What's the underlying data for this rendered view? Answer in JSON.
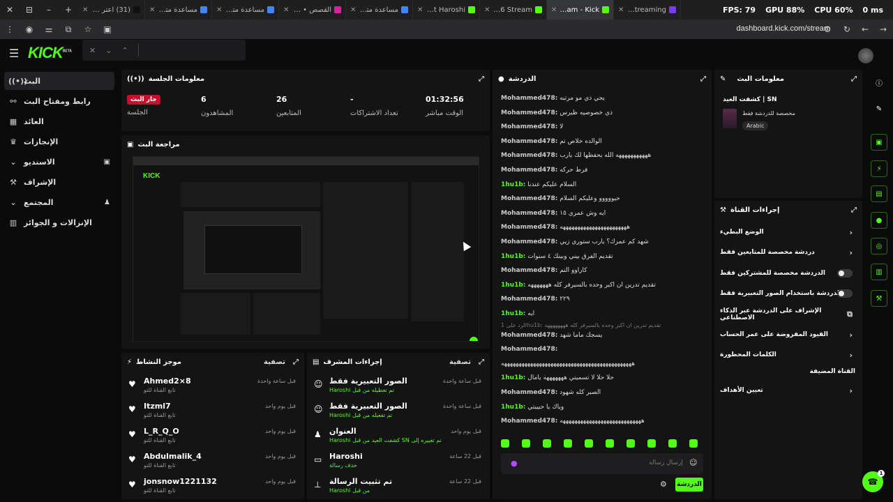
{
  "browser": {
    "tabs": [
      {
        "label": "(31) اعتر على",
        "color": "#111111"
      },
      {
        "label": "مساعدة متصفح",
        "color": "#4285f4"
      },
      {
        "label": "مساعدة متصفح",
        "color": "#4285f4"
      },
      {
        "label": "القصص • rami",
        "color": "#d6249f"
      },
      {
        "label": "مساعدة متصفح",
        "color": "#4285f4"
      },
      {
        "label": "About Haroshi",
        "color": "#53fc18"
      },
      {
        "label": "kh_e6 Stream",
        "color": "#53fc18"
      },
      {
        "label": "Stream - Kick",
        "color": "#53fc18"
      },
      {
        "label": "Kick Streaming",
        "color": "#7c3aed"
      }
    ],
    "active_tab": 7,
    "fps": "FPS: 79",
    "gpu": "GPU 88%",
    "cpu": "CPU 60%",
    "ms": "0 ms",
    "url": "dashboard.kick.com/stream"
  },
  "nav": {
    "logo": "KICK",
    "logo_tag": "BETA"
  },
  "sidebar": {
    "items": [
      {
        "label": "البث",
        "icon": "live-icon"
      },
      {
        "label": "رابط ومفتاح البث",
        "icon": "link-icon"
      },
      {
        "label": "العائد",
        "icon": "revenue-icon"
      },
      {
        "label": "الإنجازات",
        "icon": "trophy-icon"
      },
      {
        "label": "الاستديو",
        "icon": "chevron-down-icon"
      },
      {
        "label": "الإشراف",
        "icon": "wrench-icon"
      },
      {
        "label": "المجتمع",
        "icon": "chevron-down-icon"
      },
      {
        "label": "الإنزالات و الجوائز",
        "icon": "drops-icon"
      }
    ]
  },
  "session": {
    "title": "معلومات الجلسة",
    "live_badge": "جار البث",
    "session_label": "الجلسة",
    "viewers_value": "6",
    "viewers_label": "المشاهدون",
    "followers_value": "26",
    "followers_label": "المتابعين",
    "subs_value": "-",
    "subs_label": "تعداد الاشتراكات",
    "time_value": "01:32:56",
    "time_label": "الوقت مباشر"
  },
  "preview": {
    "title": "مراجعة البث"
  },
  "activity": {
    "title": "موجز النشاط",
    "filter": "تصفية",
    "items": [
      {
        "name": "Ahmed2×8",
        "sub": "تابع القناة للتو",
        "time": "قبل ساعة واحدة"
      },
      {
        "name": "Itzml7",
        "sub": "تابع القناة للتو",
        "time": "قبل يوم واحد"
      },
      {
        "name": "L_R_Q_O",
        "sub": "تابع القناة للتو",
        "time": "قبل يوم واحد"
      },
      {
        "name": "Abdulmalik_4",
        "sub": "تابع القناة للتو",
        "time": "قبل يوم واحد"
      },
      {
        "name": "jonsnow1221132",
        "sub": "تابع القناة للتو",
        "time": "قبل يوم واحد"
      }
    ]
  },
  "modactions": {
    "title": "إجراءات المشرف",
    "filter": "تصفية",
    "items": [
      {
        "name": "الصور التعبيرية فقط",
        "sub": "Haroshi تم تعطيله من قبل",
        "time": "قبل ساعة واحدة"
      },
      {
        "name": "الصور التعبيرية فقط",
        "sub": "Haroshi تم تفعيله من قبل",
        "time": "قبل ساعة واحدة"
      },
      {
        "name": "العنوان",
        "sub": "Haroshi كشفت العيد من قبل SN تم تغييره إلى",
        "time": "قبل يوم واحد"
      },
      {
        "name": "Haroshi",
        "sub": "حذف رسالة",
        "time": "قبل 22 ساعة"
      },
      {
        "name": "تم تثبيت الرسالة",
        "sub": "Haroshi من قبل",
        "time": "قبل 22 ساعة"
      }
    ]
  },
  "chat": {
    "title": "الدردشة",
    "messages": [
      {
        "user": "Mohammed478:",
        "text": "يجي ذي مو مرتبه",
        "green": false
      },
      {
        "user": "Mohammed478:",
        "text": "ذي خصوصيه ظيرس",
        "green": false
      },
      {
        "user": "Mohammed478:",
        "text": "لا",
        "green": false
      },
      {
        "user": "Mohammed478:",
        "text": "الوالده خلاص تم",
        "green": false
      },
      {
        "user": "Mohammed478:",
        "text": "هههههههههههه الله يحفظها لك يارب",
        "green": false
      },
      {
        "user": "Mohammed478:",
        "text": "فرط حركه",
        "green": false
      },
      {
        "user": "1hu1b:",
        "text": "السلام عليكم عندنا",
        "green": true
      },
      {
        "user": "Mohammed478:",
        "text": "حيووووو وعليكم السلام",
        "green": false
      },
      {
        "user": "Mohammed478:",
        "text": "ايه وش عمري ١٥",
        "green": false
      },
      {
        "user": "Mohammed478:",
        "text": "هههههههههههههههههههههههه",
        "green": false
      },
      {
        "user": "Mohammed478:",
        "text": "شهد كم عمرك؟ يارب ستوري زيي",
        "green": false
      },
      {
        "user": "1hu1b:",
        "text": "تقديم الفرق بيني وبينك ٤ سنوات",
        "green": true
      },
      {
        "user": "Mohammed478:",
        "text": "كاراوو التم",
        "green": false
      },
      {
        "user": "1hu1b:",
        "text": "تقديم تدرين ان اكبر وحده بالسيرفر كله هههههههه",
        "green": true
      },
      {
        "user": "Mohammed478:",
        "text": "٢٢٩",
        "green": false
      },
      {
        "user": "1hu1b:",
        "text": "ايه",
        "green": true
      },
      {
        "user": "Mohammed478:",
        "text": "يسجك ماما شهد",
        "green": false
      },
      {
        "user": "Mohammed478:",
        "text": "",
        "green": false
      },
      {
        "user": "",
        "text": "هههههههههههههههههههههههههههههههههههههههههههههه",
        "green": false
      },
      {
        "user": "1hu1b:",
        "text": "حلا حلا لا تسميني هههههههه يامال",
        "green": true
      },
      {
        "user": "Mohammed478:",
        "text": "الصبر كله شهود",
        "green": false
      },
      {
        "user": "1hu1b:",
        "text": "وياك يا حبيبتي",
        "green": true
      },
      {
        "user": "Mohammed478:",
        "text": "ههههههههههههههههههههههههههههه",
        "green": false
      }
    ],
    "reply_text": "الرد على 1hu1b: تقديم تدرين ان اكبر وحده بالسيرفر كله ههههههههه",
    "input_placeholder": "إرسال رسالة",
    "send_label": "الدردشة"
  },
  "streaminfo": {
    "title": "معلومات البث",
    "stream_title": "كشفت العيد | SN",
    "subtitle": "مخصصة للدردشة فقط",
    "language": "Arabic"
  },
  "channelactions": {
    "title": "إجراءات القناة",
    "items": [
      {
        "label": "الوضع البطيء",
        "kind": "arrow"
      },
      {
        "label": "دردشة مخصصة للمتابعين فقط",
        "kind": "arrow"
      },
      {
        "label": "الدردشة مخصصة للمشتركين فقط",
        "kind": "toggle"
      },
      {
        "label": "الدردشة باستخدام الصور التعبيرية فقط",
        "kind": "toggle"
      },
      {
        "label": "الإشراف على الدردشة عبر الذكاء الاصطناعي",
        "kind": "external"
      },
      {
        "label": "القيود المفروضة على عمر الحساب",
        "kind": "arrow"
      },
      {
        "label": "الكلمات المحظورة",
        "kind": "arrow"
      }
    ],
    "section_label": "القناة المضيفة",
    "set_goals": "تعيين الأهداف"
  },
  "help_badge": "1"
}
